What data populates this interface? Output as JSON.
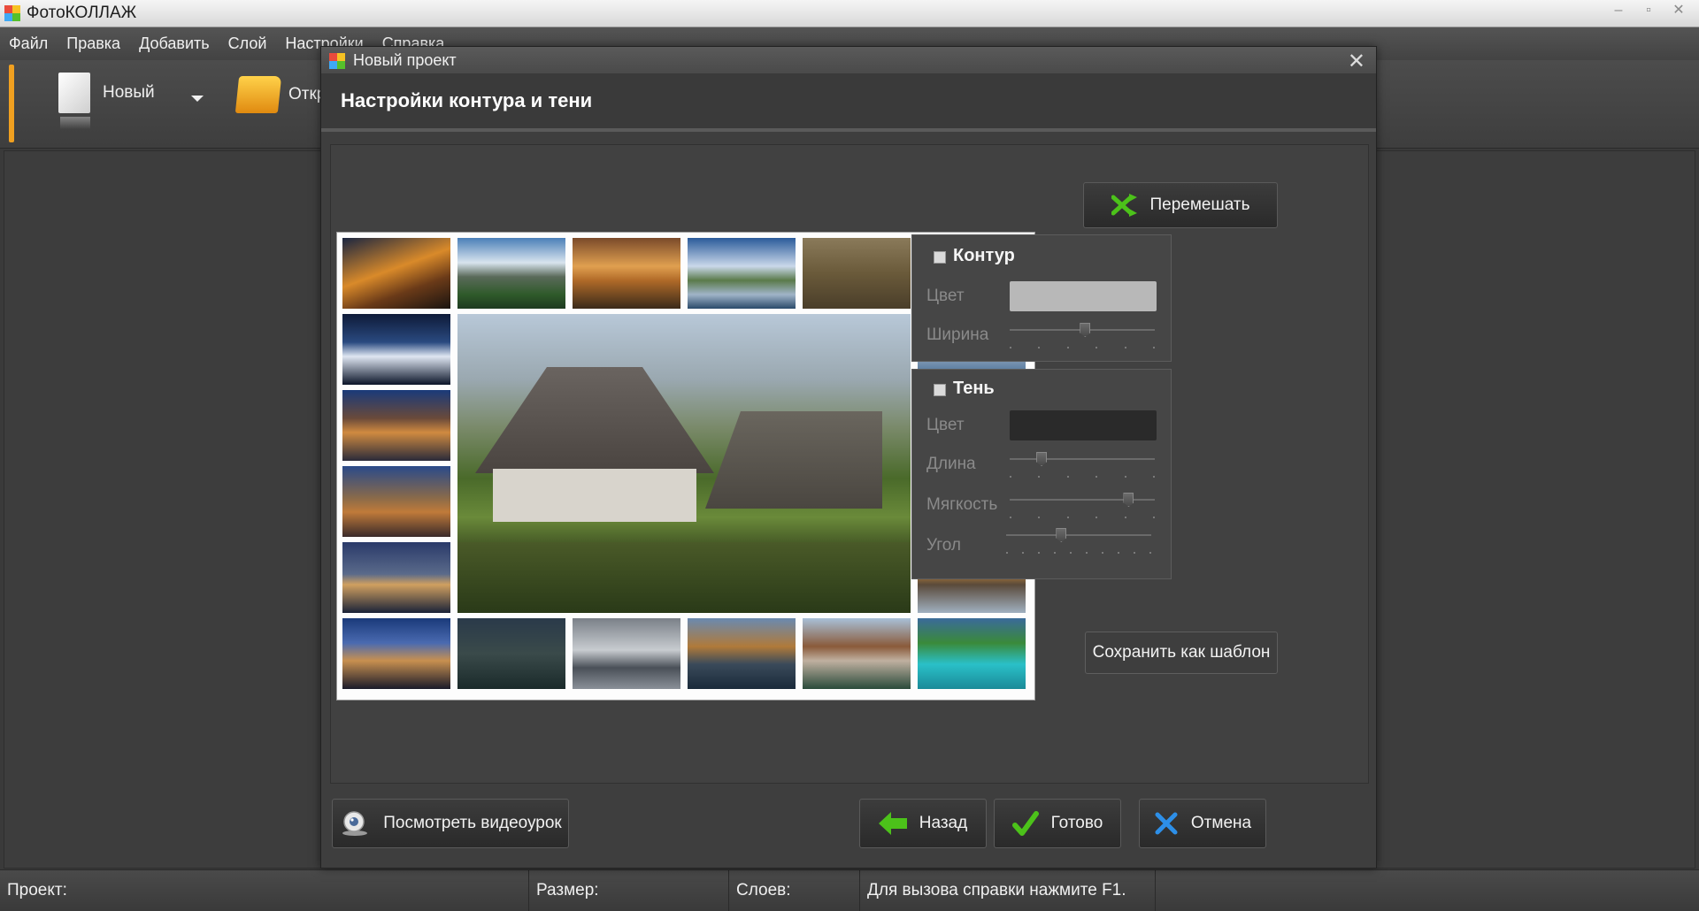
{
  "app": {
    "title": "ФотоКОЛЛАЖ"
  },
  "menu": [
    "Файл",
    "Правка",
    "Добавить",
    "Слой",
    "Настройки",
    "Справка"
  ],
  "toolbar": {
    "new_label": "Новый",
    "open_label": "Откр"
  },
  "dialog": {
    "title": "Новый проект",
    "heading": "Настройки контура и тени",
    "shuffle_label": "Перемешать",
    "save_template_label": "Сохранить как шаблон",
    "video_label": "Посмотреть видеоурок",
    "back_label": "Назад",
    "done_label": "Готово",
    "cancel_label": "Отмена",
    "outline": {
      "title": "Контур",
      "checked": false,
      "color_label": "Цвет",
      "color": "#b8b8b8",
      "width_label": "Ширина",
      "width_value": 0.52
    },
    "shadow": {
      "title": "Тень",
      "checked": false,
      "color_label": "Цвет",
      "color": "#2a2a2a",
      "length_label": "Длина",
      "length_value": 0.22,
      "softness_label": "Мягкость",
      "softness_value": 0.82,
      "angle_label": "Угол",
      "angle_value": 0.38
    }
  },
  "status": {
    "project_label": "Проект:",
    "size_label": "Размер:",
    "layers_label": "Слоев:",
    "help_text": "Для вызова справки нажмите F1."
  },
  "colors": {
    "accent": "#f0a020",
    "green_icon": "#4cc21a",
    "blue_icon": "#2d8fe8"
  }
}
